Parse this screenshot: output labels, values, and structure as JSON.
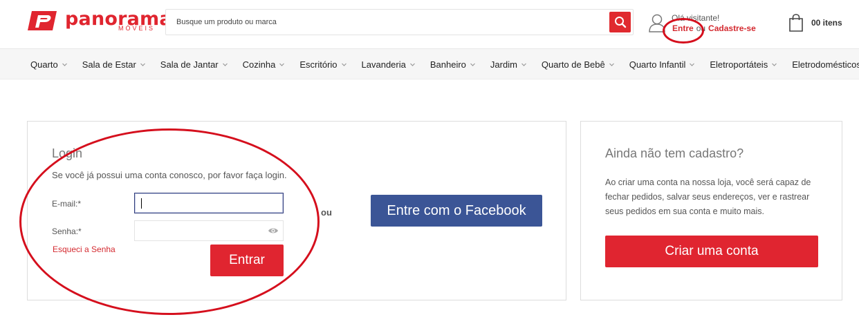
{
  "brand": {
    "name": "panorama",
    "sub": "MÓVEIS",
    "color": "#e0252f"
  },
  "search": {
    "placeholder": "Busque um produto ou marca",
    "icon": "search-icon"
  },
  "account": {
    "greeting": "Olá visitante!",
    "login_link": "Entre",
    "or": "ou",
    "register_link": "Cadastre-se"
  },
  "cart": {
    "count_label": "00 itens",
    "icon": "shopping-bag-icon"
  },
  "nav": {
    "items": [
      {
        "label": "Quarto"
      },
      {
        "label": "Sala de Estar"
      },
      {
        "label": "Sala de Jantar"
      },
      {
        "label": "Cozinha"
      },
      {
        "label": "Escritório"
      },
      {
        "label": "Lavanderia"
      },
      {
        "label": "Banheiro"
      },
      {
        "label": "Jardim"
      },
      {
        "label": "Quarto de Bebê"
      },
      {
        "label": "Quarto Infantil"
      },
      {
        "label": "Eletroportáteis"
      },
      {
        "label": "Eletrodomésticos"
      }
    ]
  },
  "login": {
    "title": "Login",
    "description": "Se você já possui uma conta conosco, por favor faça login.",
    "email_label": "E-mail:*",
    "email_value": "",
    "password_label": "Senha:*",
    "password_value": "",
    "forgot_label": "Esqueci a Senha",
    "submit_label": "Entrar",
    "or_label": "ou",
    "facebook_label": "Entre com o Facebook"
  },
  "register": {
    "title": "Ainda não tem cadastro?",
    "description": "Ao criar uma conta na nossa loja, você será capaz de fechar pedidos, salvar seus endereços, ver e rastrear seus pedidos em sua conta e muito mais.",
    "button_label": "Criar uma conta"
  },
  "colors": {
    "accent": "#e02530",
    "facebook": "#3b5596",
    "annotation": "#d50f1d"
  }
}
